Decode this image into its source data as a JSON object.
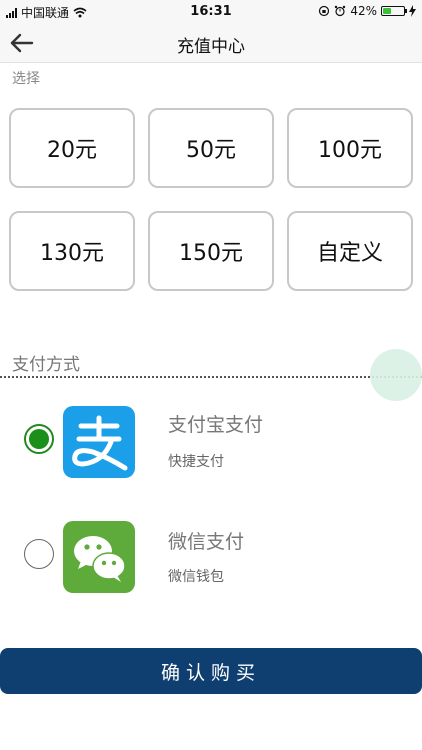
{
  "status_bar": {
    "carrier": "中国联通",
    "time": "16:31",
    "battery_text": "42%",
    "battery_level": 0.42
  },
  "nav": {
    "back_icon": "arrow-left-icon",
    "title": "充值中心"
  },
  "select_label": "选择",
  "amounts": [
    "20元",
    "50元",
    "100元",
    "130元",
    "150元",
    "自定义"
  ],
  "payment": {
    "label": "支付方式",
    "methods": [
      {
        "title": "支付宝支付",
        "subtitle": "快捷支付",
        "icon": "alipay-icon",
        "selected": true,
        "icon_color": "#1a9fe8"
      },
      {
        "title": "微信支付",
        "subtitle": "微信钱包",
        "icon": "wechat-icon",
        "selected": false,
        "icon_color": "#5eaa3a"
      }
    ]
  },
  "buy_button": {
    "label": "确认购买",
    "color": "#0f3f70"
  }
}
